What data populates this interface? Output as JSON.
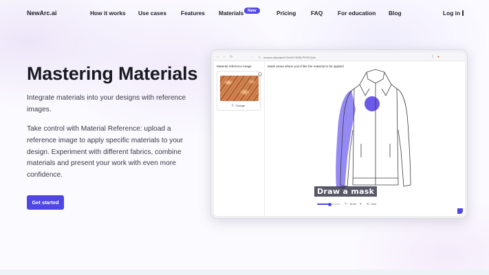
{
  "nav": {
    "logo": "NewArc.ai",
    "items": [
      {
        "label": "How it works"
      },
      {
        "label": "Use cases"
      },
      {
        "label": "Features"
      },
      {
        "label": "Materials",
        "badge": "New"
      },
      {
        "label": "Pricing"
      },
      {
        "label": "FAQ"
      },
      {
        "label": "For education"
      },
      {
        "label": "Blog"
      }
    ],
    "login": "Log in"
  },
  "hero": {
    "title": "Mastering Materials",
    "subtitle": "Integrate materials into your designs with reference images.",
    "description": "Take control with Material Reference: upload a reference image to apply specific materials to your design. Experiment with different fabrics, combine materials and present your work with even more confidence.",
    "cta": "Get started"
  },
  "demo": {
    "url": "newarc.ai/project/7/ieuiGYK6SLPlXKOQnk",
    "left_label": "Material reference image",
    "right_label": "Mask areas where you'd like the material to be applied",
    "change_button": "Change",
    "caption": "Draw a mask",
    "toolbar": {
      "brush_label": "Brush",
      "clear_label": "Clear",
      "brush_size": 0.55
    },
    "mask_color": "#7b6cf0"
  },
  "colors": {
    "accent": "#4f46e5"
  }
}
